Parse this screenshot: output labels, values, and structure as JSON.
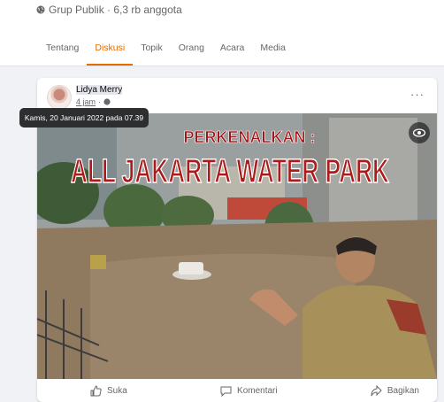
{
  "group": {
    "meta": "Grup Publik · 6,3 rb anggota"
  },
  "tabs": [
    {
      "label": "Tentang",
      "active": false
    },
    {
      "label": "Diskusi",
      "active": true
    },
    {
      "label": "Topik",
      "active": false
    },
    {
      "label": "Orang",
      "active": false
    },
    {
      "label": "Acara",
      "active": false
    },
    {
      "label": "Media",
      "active": false
    }
  ],
  "post": {
    "author": "Lidya Merry",
    "time": "4 jam",
    "separator": "·",
    "tooltip": "Kamis, 20 Januari 2022 pada 07.39",
    "more": "···",
    "image": {
      "line1": "PERKENALKAN :",
      "line2": "ALL JAKARTA WATER PARK"
    },
    "actions": {
      "like": "Suka",
      "comment": "Komentari",
      "share": "Bagikan"
    }
  },
  "colors": {
    "accent": "#e36d00",
    "secondary_text": "#65676b",
    "background": "#f0f2f5"
  }
}
